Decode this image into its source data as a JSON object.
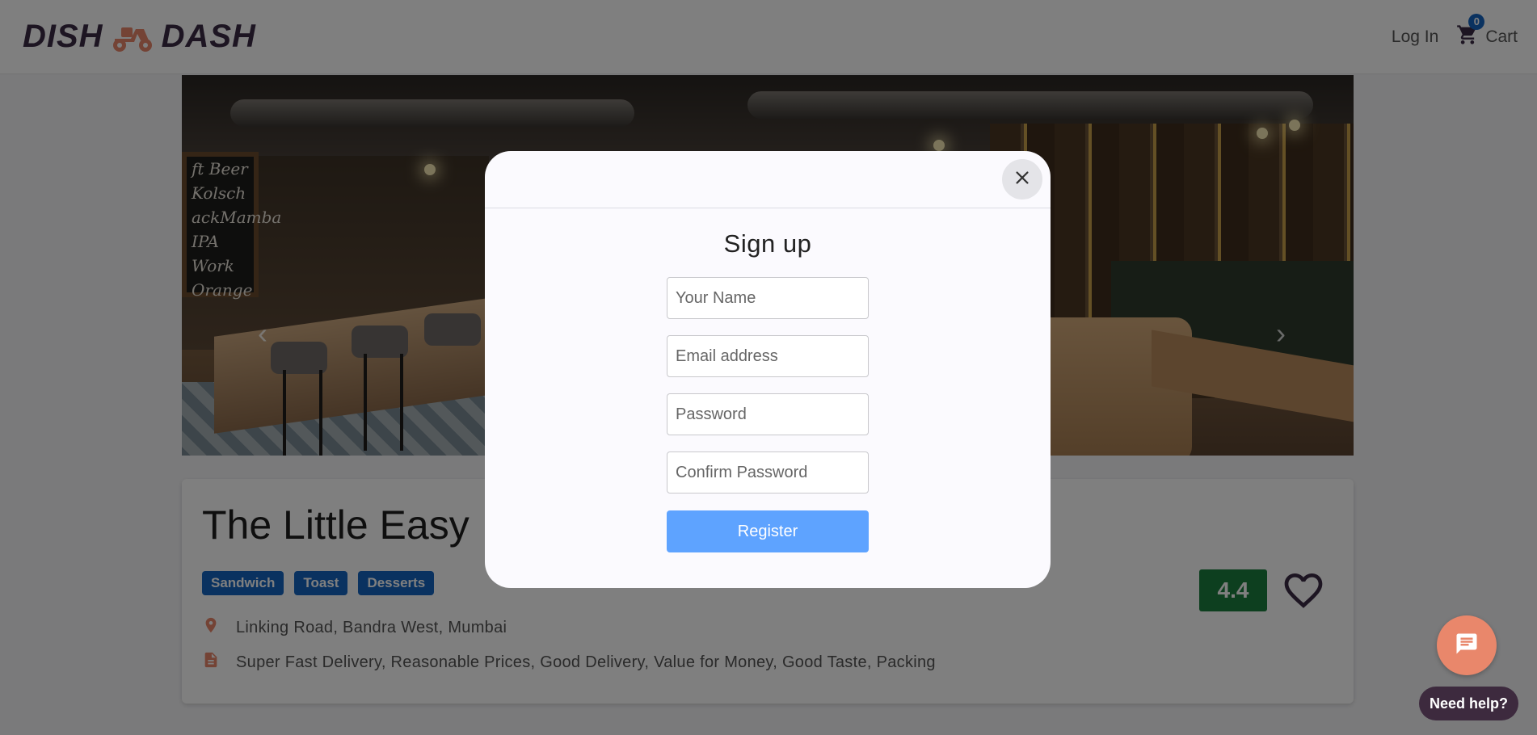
{
  "header": {
    "logo_left": "DISH",
    "logo_right": "DASH",
    "login_label": "Log In",
    "cart_label": "Cart",
    "cart_count": "0"
  },
  "hero": {
    "chalkboard_lines": [
      "ft Beer",
      "Kolsch",
      "ackMamba",
      "IPA",
      "Work",
      "Orange"
    ]
  },
  "restaurant": {
    "name": "The Little Easy",
    "tags": [
      "Sandwich",
      "Toast",
      "Desserts"
    ],
    "address": "Linking Road, Bandra West, Mumbai",
    "highlights": "Super Fast Delivery, Reasonable Prices, Good Delivery, Value for Money, Good Taste, Packing",
    "rating": "4.4",
    "rating_color": "#1b7f3f",
    "tag_color": "#1565c0"
  },
  "modal": {
    "title": "Sign up",
    "fields": {
      "name_placeholder": "Your Name",
      "email_placeholder": "Email address",
      "password_placeholder": "Password",
      "confirm_placeholder": "Confirm Password"
    },
    "register_label": "Register",
    "register_color": "#5ea3ff"
  },
  "chat": {
    "help_label": "Need help?"
  },
  "icons": {
    "logo": "scooter-icon",
    "cart": "cart-icon",
    "close": "close-icon",
    "location": "location-pin-icon",
    "document": "document-icon",
    "favorite": "heart-outline-icon",
    "chat": "chat-icon",
    "prev": "chevron-left-icon",
    "next": "chevron-right-icon"
  }
}
